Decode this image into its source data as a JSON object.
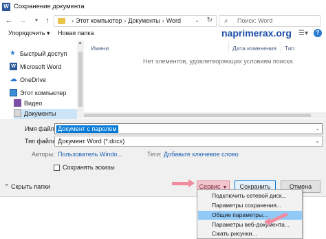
{
  "window": {
    "title": "Сохранение документа",
    "app_icon": "word-icon",
    "app_icon_letter": "W"
  },
  "address_bar": {
    "breadcrumbs": [
      "Этот компьютер",
      "Документы",
      "Word"
    ],
    "separator": "›",
    "search_placeholder": "Поиск: Word"
  },
  "toolbar": {
    "organize_label": "Упорядочить ▾",
    "new_folder_label": "Новая папка",
    "watermark": "naprimerax.org"
  },
  "nav_pane": {
    "items": [
      {
        "label": "Быстрый доступ",
        "icon": "star-icon"
      },
      {
        "label": "Microsoft Word",
        "icon": "word-icon"
      },
      {
        "label": "OneDrive",
        "icon": "cloud-icon"
      },
      {
        "label": "Этот компьютер",
        "icon": "computer-icon"
      },
      {
        "label": "Видео",
        "icon": "video-folder-icon"
      },
      {
        "label": "Документы",
        "icon": "documents-folder-icon",
        "selected": true
      }
    ]
  },
  "file_list": {
    "columns": [
      "Имени",
      "Дата изменения",
      "Тип"
    ],
    "empty_message": "Нет элементов, удовлетворяющих условиям поиска."
  },
  "form": {
    "filename_label": "Имя файла:",
    "filename_value": "Документ с паролем",
    "filetype_label": "Тип файла:",
    "filetype_value": "Документ Word (*.docx)",
    "authors_label": "Авторы:",
    "authors_value": "Пользователь Windo...",
    "tags_label": "Теги:",
    "tags_value": "Добавьте ключевое слово",
    "thumbnails_label": "Сохранять эскизы",
    "thumbnails_checked": false
  },
  "bottom": {
    "hide_folders_label": "Скрыть папки",
    "service_label": "Сервис",
    "save_label": "Сохранить",
    "cancel_label": "Отмена"
  },
  "service_menu": {
    "items": [
      {
        "label": "Подключить сетевой диск..."
      },
      {
        "label": "Параметры сохранения..."
      },
      {
        "label": "Общие параметры...",
        "highlighted": true
      },
      {
        "label": "Параметры веб-документа..."
      },
      {
        "label": "Сжать рисунки..."
      }
    ]
  },
  "colors": {
    "accent": "#0078d7",
    "annotation_arrow": "#f08c9f",
    "service_button": "#f2c4ce",
    "highlight": "#91c9f7",
    "watermark": "#1d4fa6"
  }
}
